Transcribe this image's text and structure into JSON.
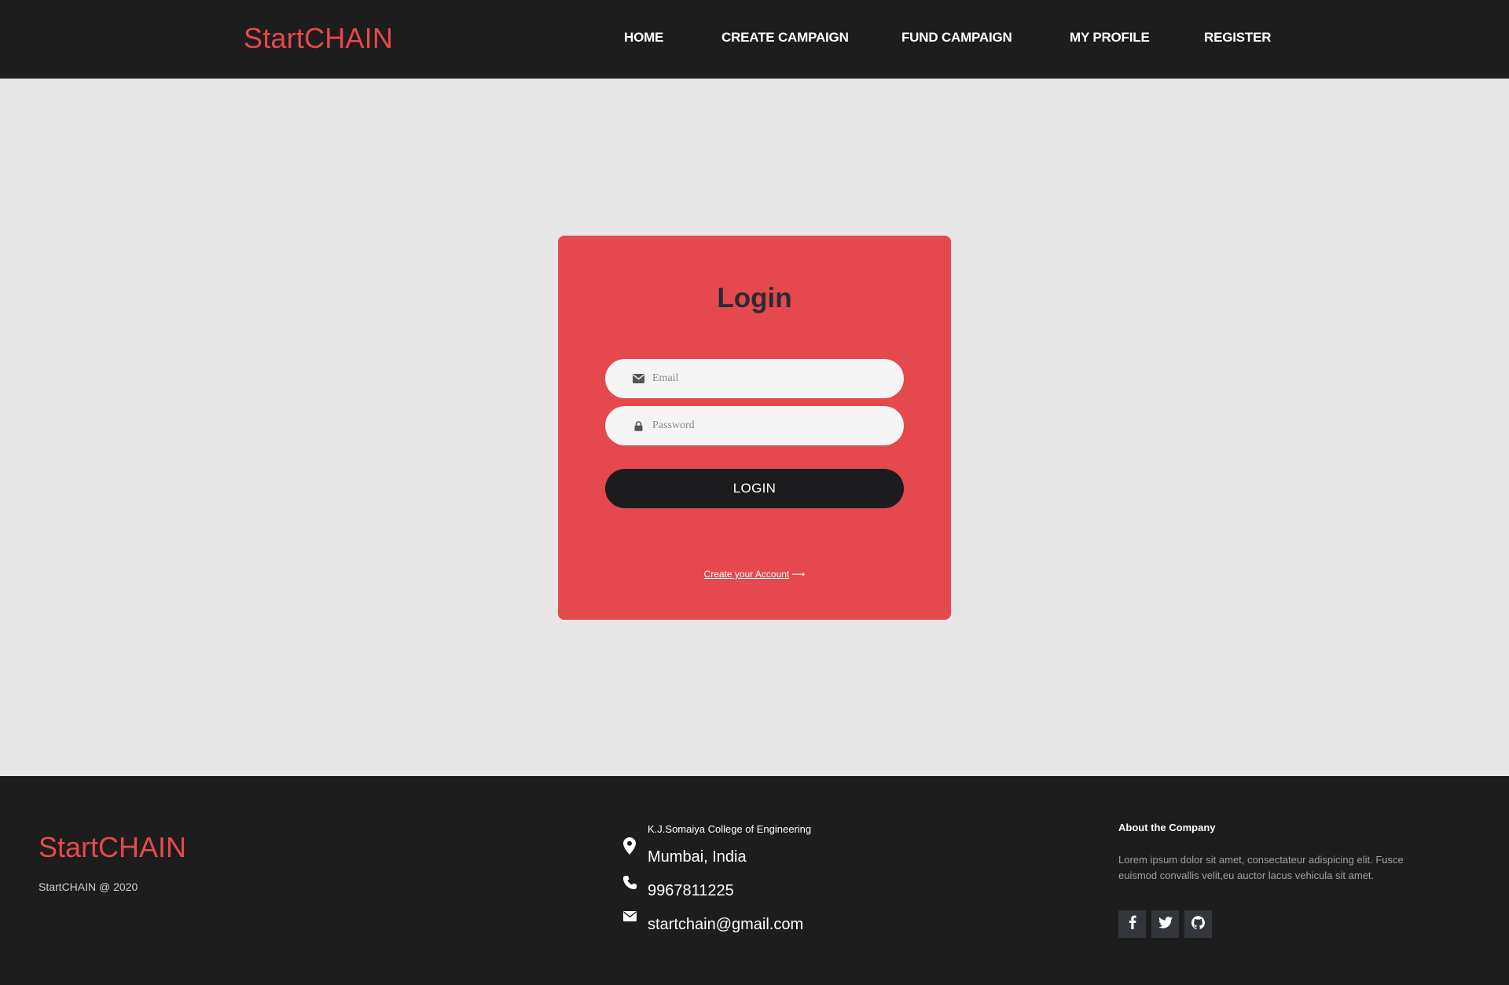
{
  "header": {
    "brand": "StartCHAIN",
    "nav": [
      {
        "label": "HOME"
      },
      {
        "label": "CREATE CAMPAIGN"
      },
      {
        "label": "FUND CAMPAIGN"
      },
      {
        "label": "MY PROFILE"
      },
      {
        "label": "REGISTER"
      }
    ]
  },
  "login": {
    "title": "Login",
    "email_placeholder": "Email",
    "email_value": "",
    "password_placeholder": "Password",
    "password_value": "",
    "button_label": "LOGIN",
    "create_account_label": "Create your Account",
    "create_account_arrow": "⟶"
  },
  "footer": {
    "brand": "StartCHAIN",
    "copyright": "StartCHAIN @ 2020",
    "address_line1": "K.J.Somaiya College of Engineering",
    "address_line2": "Mumbai, India",
    "phone": "9967811225",
    "email": "startchain@gmail.com",
    "about_title": "About the Company",
    "about_text": "Lorem ipsum dolor sit amet, consectateur adispicing elit. Fusce euismod convallis velit,eu auctor lacus vehicula sit amet.",
    "social": [
      {
        "icon": "facebook-icon"
      },
      {
        "icon": "twitter-icon"
      },
      {
        "icon": "github-icon"
      }
    ]
  },
  "colors": {
    "accent": "#e5484d",
    "dark": "#1d1d1d",
    "background": "#e6e6e6"
  }
}
